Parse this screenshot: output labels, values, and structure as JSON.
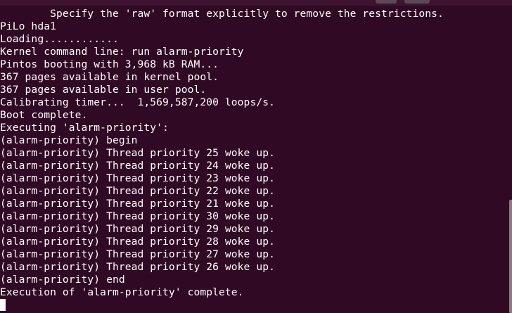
{
  "terminal": {
    "lines": [
      "        Specify the 'raw' format explicitly to remove the restrictions.",
      "PiLo hda1",
      "Loading............",
      "Kernel command line: run alarm-priority",
      "Pintos booting with 3,968 kB RAM...",
      "367 pages available in kernel pool.",
      "367 pages available in user pool.",
      "Calibrating timer...  1,569,587,200 loops/s.",
      "Boot complete.",
      "Executing 'alarm-priority':",
      "(alarm-priority) begin",
      "(alarm-priority) Thread priority 25 woke up.",
      "(alarm-priority) Thread priority 24 woke up.",
      "(alarm-priority) Thread priority 23 woke up.",
      "(alarm-priority) Thread priority 22 woke up.",
      "(alarm-priority) Thread priority 21 woke up.",
      "(alarm-priority) Thread priority 30 woke up.",
      "(alarm-priority) Thread priority 29 woke up.",
      "(alarm-priority) Thread priority 28 woke up.",
      "(alarm-priority) Thread priority 27 woke up.",
      "(alarm-priority) Thread priority 26 woke up.",
      "(alarm-priority) end",
      "Execution of 'alarm-priority' complete."
    ]
  },
  "colors": {
    "background": "#300a24",
    "foreground": "#ffffff"
  }
}
